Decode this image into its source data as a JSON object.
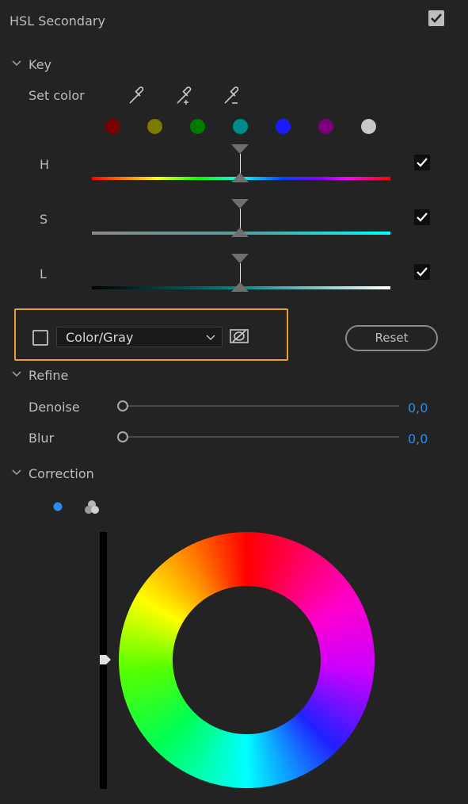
{
  "panel": {
    "title": "HSL Secondary",
    "enabled": true
  },
  "key": {
    "section_label": "Key",
    "set_color_label": "Set color",
    "eyedroppers": [
      "eyedropper-icon",
      "eyedropper-add-icon",
      "eyedropper-subtract-icon"
    ],
    "swatches": [
      "#7a0000",
      "#7a7a00",
      "#007a00",
      "#008a8a",
      "#1a1aff",
      "#7a007a",
      "#c8c8c8"
    ],
    "sliders": [
      {
        "label": "H",
        "checked": true
      },
      {
        "label": "S",
        "checked": true
      },
      {
        "label": "L",
        "checked": true
      }
    ],
    "show_mask_checked": false,
    "mask_mode": "Color/Gray",
    "reset_label": "Reset"
  },
  "refine": {
    "section_label": "Refine",
    "denoise": {
      "label": "Denoise",
      "value": "0,0"
    },
    "blur": {
      "label": "Blur",
      "value": "0,0"
    }
  },
  "correction": {
    "section_label": "Correction",
    "modes": [
      "single-wheel-icon",
      "three-wheels-icon"
    ]
  },
  "colors": {
    "accent_value": "#2d8ceb",
    "highlight_border": "#e8a030"
  }
}
